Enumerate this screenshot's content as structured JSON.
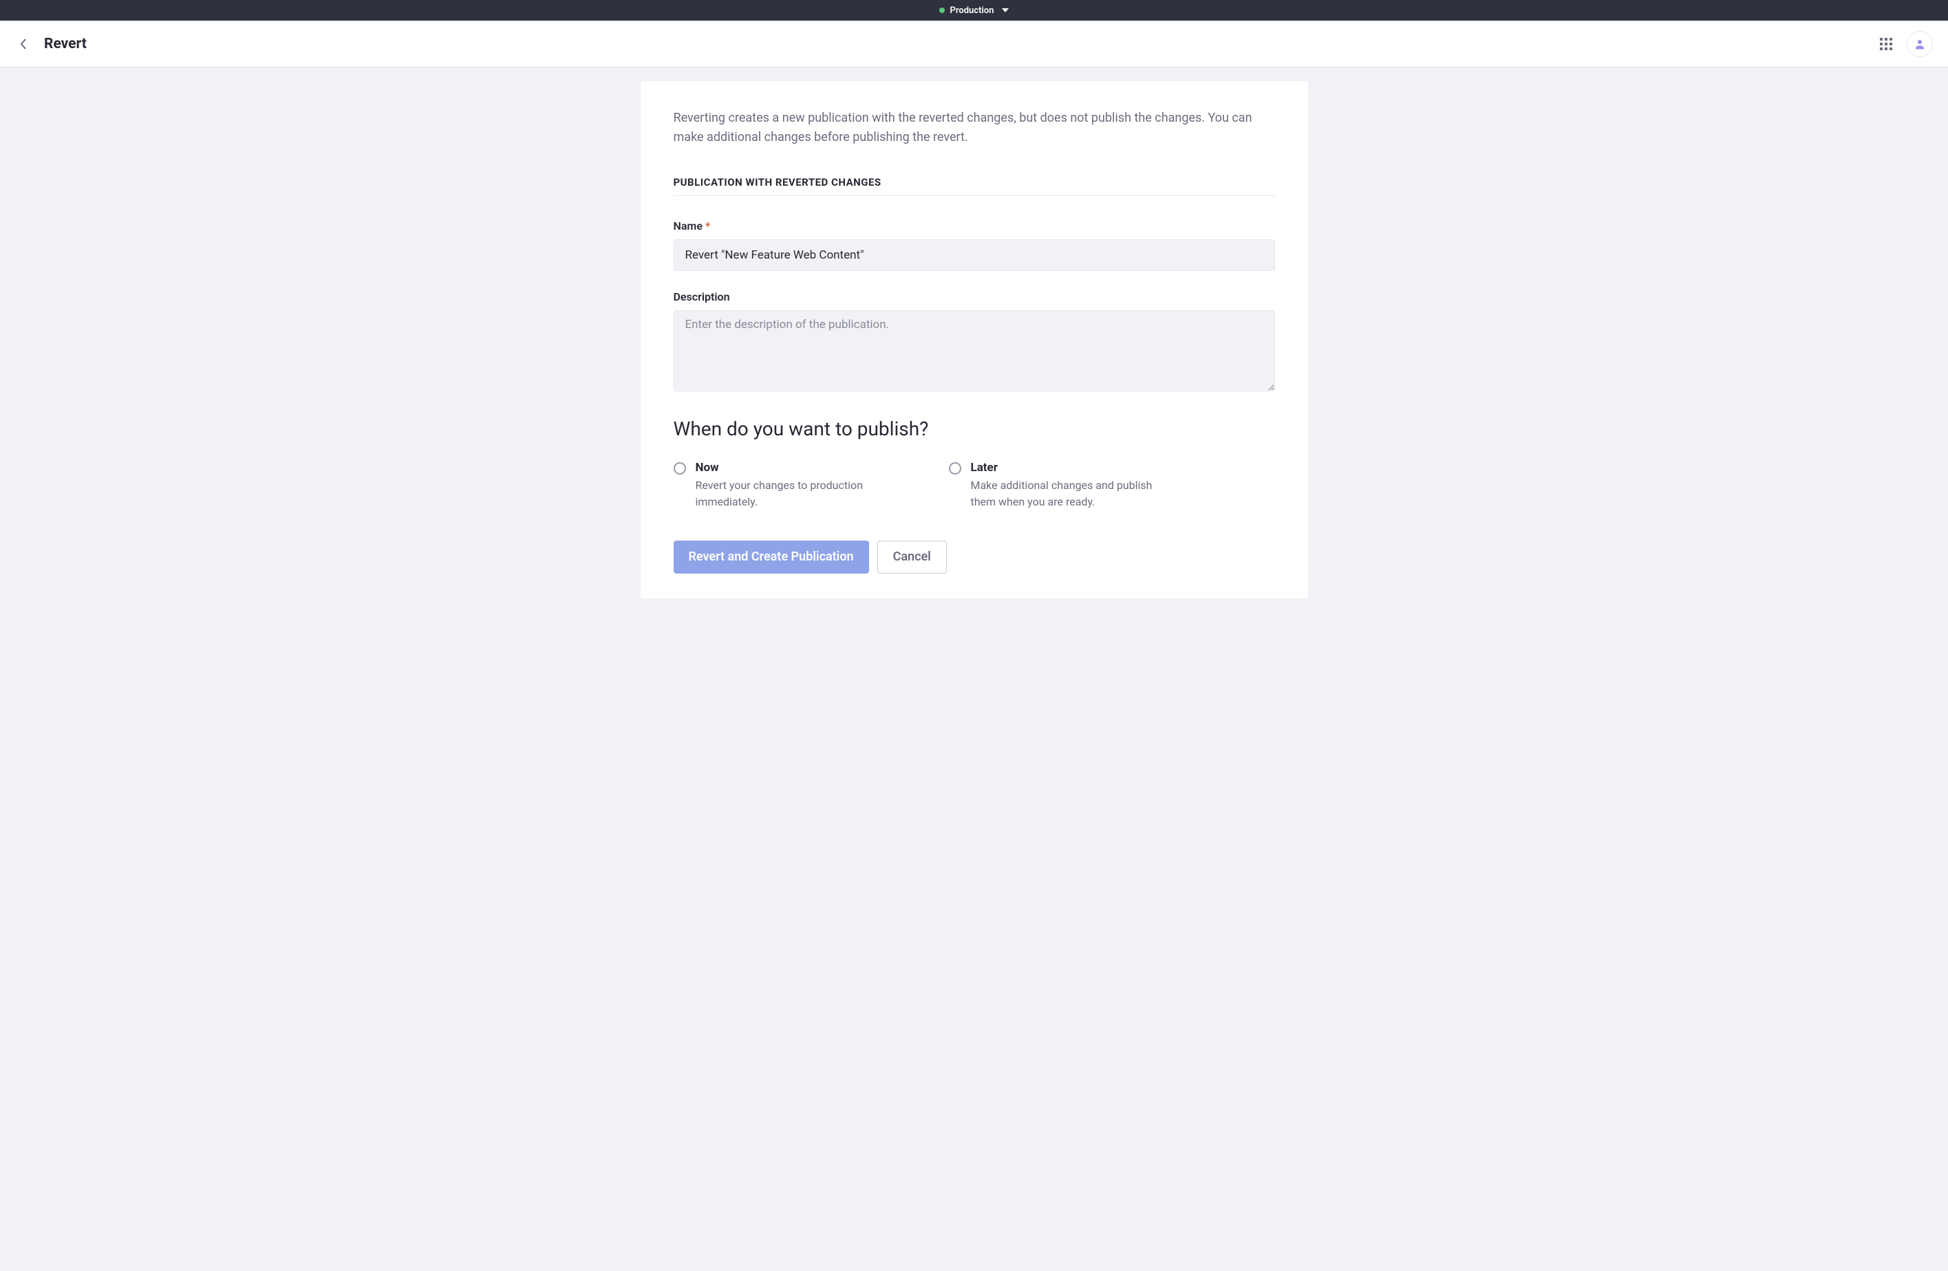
{
  "topbar": {
    "env_label": "Production"
  },
  "header": {
    "title": "Revert"
  },
  "intro_text": "Reverting creates a new publication with the reverted changes, but does not publish the changes. You can make additional changes before publishing the revert.",
  "section_header": "PUBLICATION WITH REVERTED CHANGES",
  "name_field": {
    "label": "Name",
    "required_mark": "*",
    "value": "Revert \"New Feature Web Content\""
  },
  "description_field": {
    "label": "Description",
    "placeholder": "Enter the description of the publication.",
    "value": ""
  },
  "publish_heading": "When do you want to publish?",
  "radio_now": {
    "label": "Now",
    "desc": "Revert your changes to production immediately."
  },
  "radio_later": {
    "label": "Later",
    "desc": "Make additional changes and publish them when you are ready."
  },
  "actions": {
    "primary": "Revert and Create Publication",
    "cancel": "Cancel"
  }
}
